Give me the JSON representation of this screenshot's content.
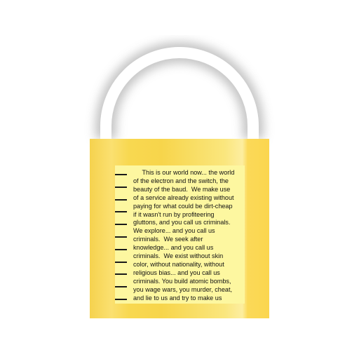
{
  "image": {
    "icon": "padlock-icon",
    "colors": {
      "lock_body": "#f7d54b",
      "note_paper": "#fdf7a0",
      "shackle": "#ffffff",
      "shackle_shadow": "#d0d0d0",
      "text": "#111111"
    }
  },
  "note": {
    "lines": [
      "     This is our world now... the world",
      "of the electron and the switch, the",
      "beauty of the baud.  We make use",
      "of a service already existing without",
      "paying for what could be dirt-cheap",
      "if it wasn't run by profiteering",
      "gluttons, and you call us criminals.",
      "We explore... and you call us",
      "criminals.  We seek after",
      "knowledge... and you call us",
      "criminals.  We exist without skin",
      "color, without nationality, without",
      "religious bias... and you call us",
      "criminals. You build atomic bombs,",
      "you wage wars, you murder, cheat,",
      "and lie to us and try to make us"
    ]
  }
}
